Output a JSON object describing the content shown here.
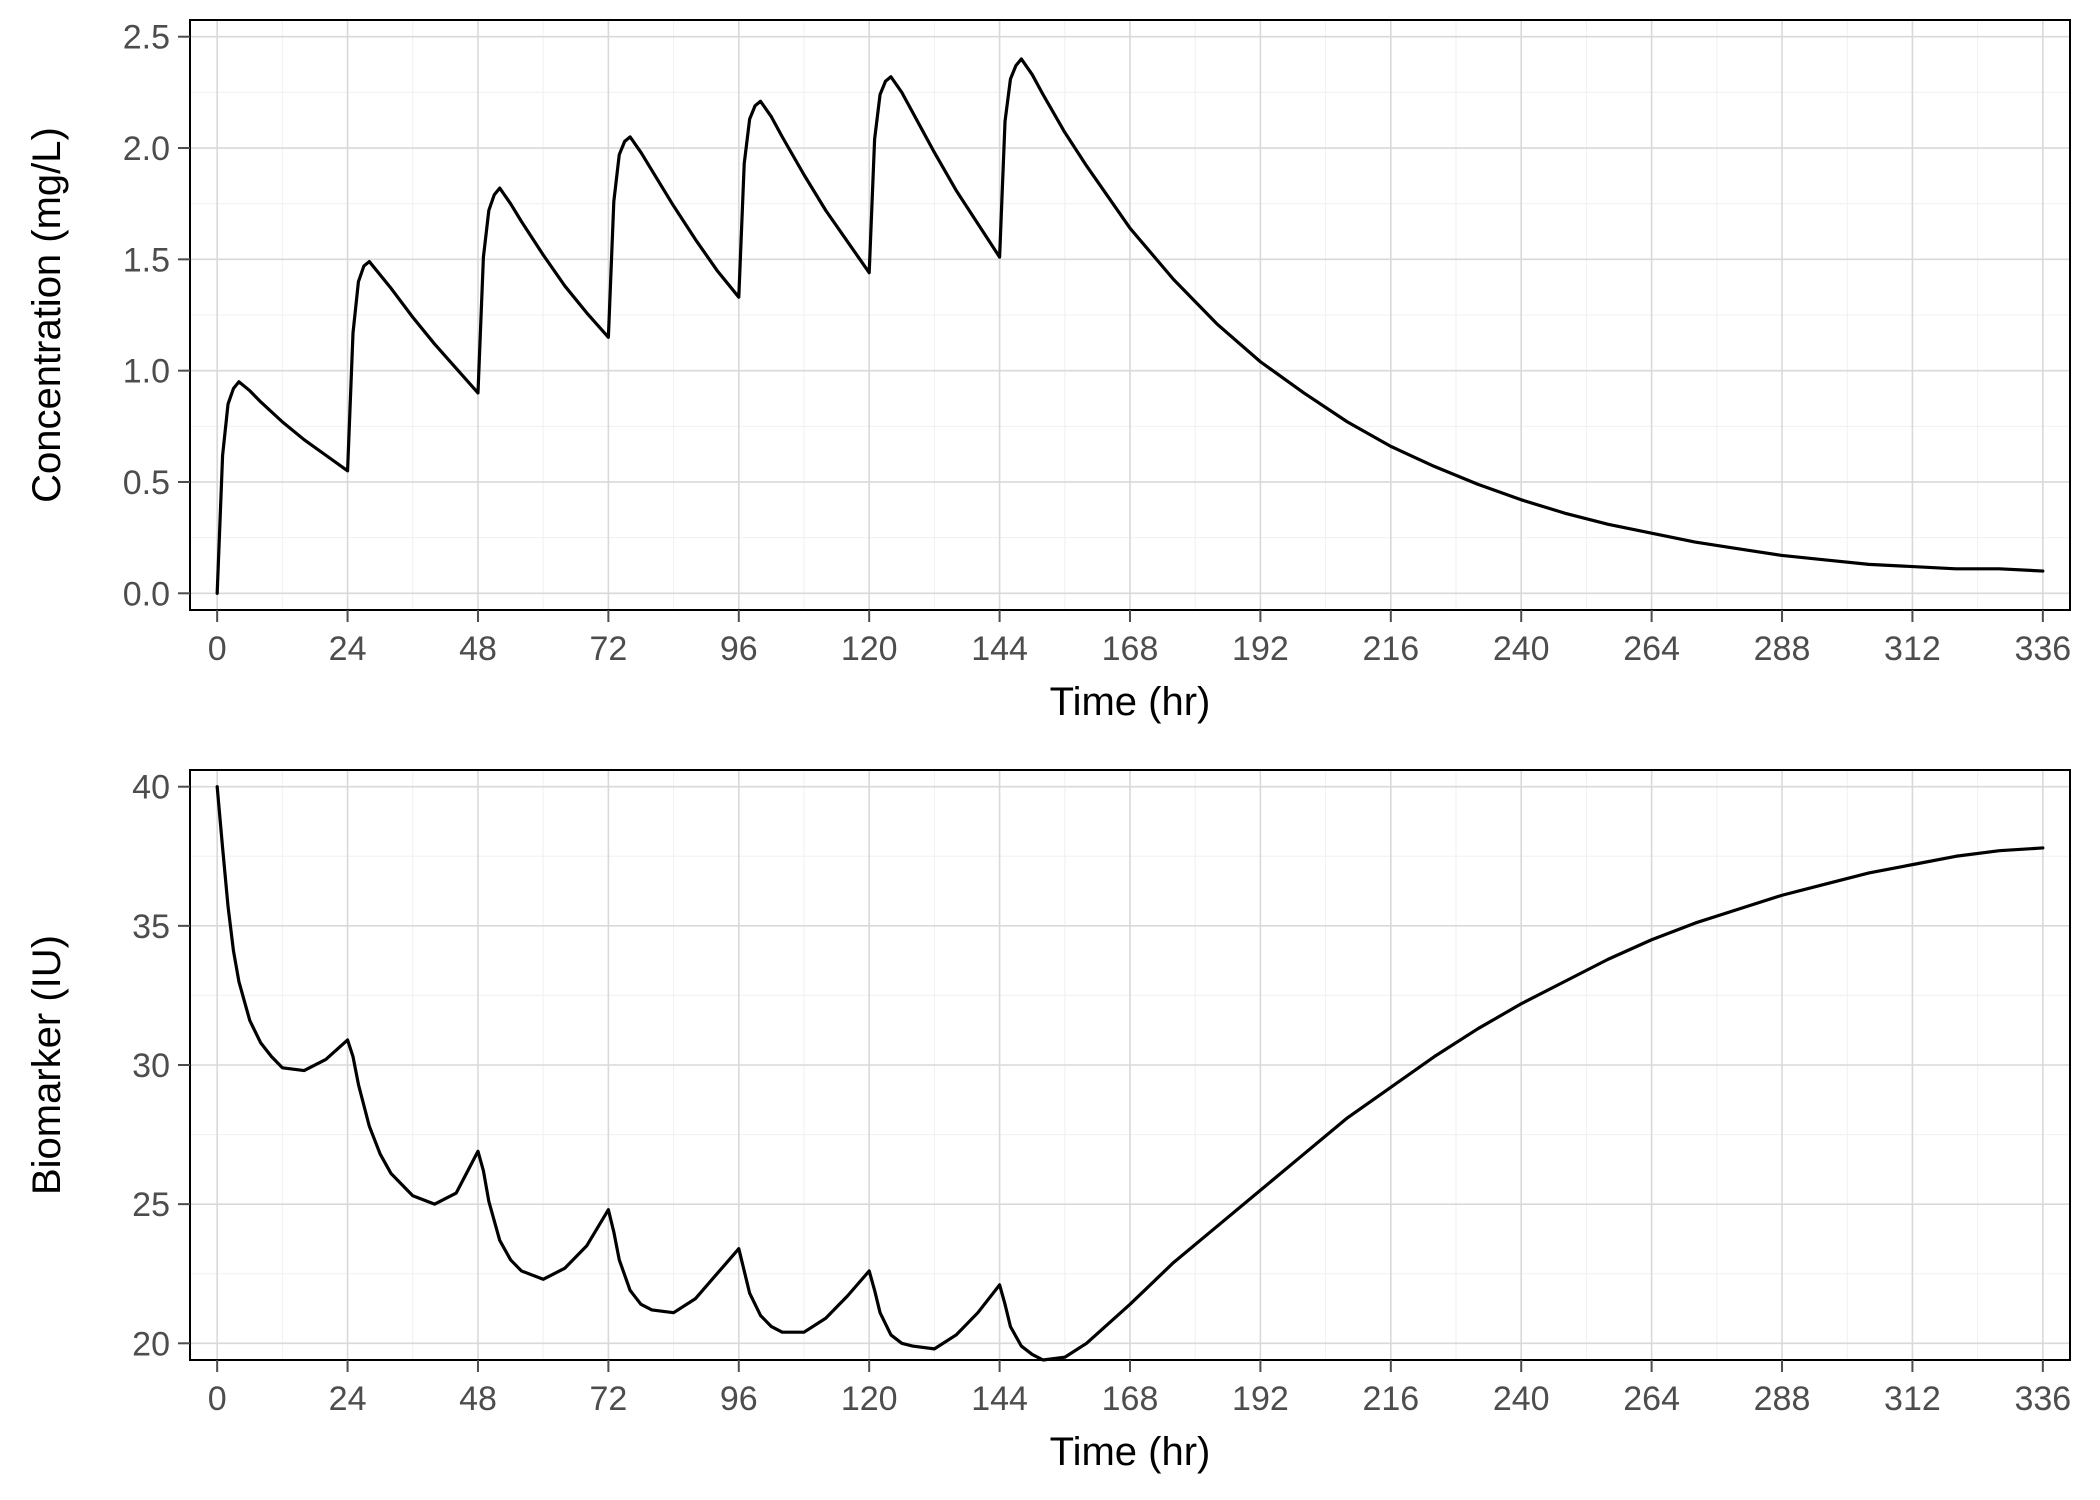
{
  "chart_data": [
    {
      "type": "line",
      "panel": "top",
      "xlabel": "Time (hr)",
      "ylabel": "Concentration (mg/L)",
      "xlim": [
        0,
        336
      ],
      "ylim": [
        0.0,
        2.5
      ],
      "x_ticks": [
        0,
        24,
        48,
        72,
        96,
        120,
        144,
        168,
        192,
        216,
        240,
        264,
        288,
        312,
        336
      ],
      "y_ticks": [
        0.0,
        0.5,
        1.0,
        1.5,
        2.0,
        2.5
      ],
      "y_minor": [
        0.25,
        0.75,
        1.25,
        1.75,
        2.25
      ],
      "series": [
        {
          "name": "Concentration",
          "x": [
            0,
            1,
            2,
            3,
            4,
            6,
            8,
            12,
            16,
            20,
            24,
            25,
            26,
            27,
            28,
            30,
            32,
            36,
            40,
            44,
            48,
            49,
            50,
            51,
            52,
            54,
            56,
            60,
            64,
            68,
            72,
            73,
            74,
            75,
            76,
            78,
            80,
            84,
            88,
            92,
            96,
            97,
            98,
            99,
            100,
            102,
            104,
            108,
            112,
            116,
            120,
            121,
            122,
            123,
            124,
            126,
            128,
            132,
            136,
            140,
            144,
            145,
            146,
            147,
            148,
            150,
            152,
            156,
            160,
            168,
            176,
            184,
            192,
            200,
            208,
            216,
            224,
            232,
            240,
            248,
            256,
            264,
            272,
            280,
            288,
            296,
            304,
            312,
            320,
            328,
            336
          ],
          "y": [
            0.0,
            0.62,
            0.85,
            0.92,
            0.95,
            0.91,
            0.86,
            0.77,
            0.69,
            0.62,
            0.55,
            1.17,
            1.4,
            1.47,
            1.49,
            1.43,
            1.37,
            1.24,
            1.12,
            1.01,
            0.9,
            1.51,
            1.72,
            1.79,
            1.82,
            1.75,
            1.67,
            1.52,
            1.38,
            1.26,
            1.15,
            1.76,
            1.97,
            2.03,
            2.05,
            1.98,
            1.9,
            1.74,
            1.59,
            1.45,
            1.33,
            1.93,
            2.13,
            2.19,
            2.21,
            2.14,
            2.05,
            1.88,
            1.72,
            1.58,
            1.44,
            2.04,
            2.24,
            2.3,
            2.32,
            2.25,
            2.16,
            1.98,
            1.81,
            1.66,
            1.51,
            2.12,
            2.31,
            2.37,
            2.4,
            2.33,
            2.24,
            2.07,
            1.92,
            1.64,
            1.41,
            1.21,
            1.04,
            0.9,
            0.77,
            0.66,
            0.57,
            0.49,
            0.42,
            0.36,
            0.31,
            0.27,
            0.23,
            0.2,
            0.17,
            0.15,
            0.13,
            0.12,
            0.11,
            0.11,
            0.1
          ]
        }
      ]
    },
    {
      "type": "line",
      "panel": "bottom",
      "xlabel": "Time (hr)",
      "ylabel": "Biomarker (IU)",
      "xlim": [
        0,
        336
      ],
      "ylim": [
        20,
        40
      ],
      "x_ticks": [
        0,
        24,
        48,
        72,
        96,
        120,
        144,
        168,
        192,
        216,
        240,
        264,
        288,
        312,
        336
      ],
      "y_ticks": [
        20,
        25,
        30,
        35,
        40
      ],
      "y_minor": [
        22.5,
        27.5,
        32.5,
        37.5
      ],
      "series": [
        {
          "name": "Biomarker",
          "x": [
            0,
            1,
            2,
            3,
            4,
            6,
            8,
            10,
            12,
            16,
            20,
            24,
            25,
            26,
            28,
            30,
            32,
            36,
            40,
            44,
            48,
            49,
            50,
            52,
            54,
            56,
            60,
            64,
            68,
            72,
            73,
            74,
            76,
            78,
            80,
            84,
            88,
            92,
            96,
            97,
            98,
            100,
            102,
            104,
            108,
            112,
            116,
            120,
            121,
            122,
            124,
            126,
            128,
            132,
            136,
            140,
            144,
            145,
            146,
            148,
            150,
            152,
            156,
            160,
            168,
            176,
            184,
            192,
            200,
            208,
            216,
            224,
            232,
            240,
            248,
            256,
            264,
            272,
            280,
            288,
            296,
            304,
            312,
            320,
            328,
            336
          ],
          "y": [
            40.0,
            37.8,
            35.7,
            34.1,
            33.0,
            31.6,
            30.8,
            30.3,
            29.9,
            29.8,
            30.2,
            30.9,
            30.3,
            29.3,
            27.8,
            26.8,
            26.1,
            25.3,
            25.0,
            25.4,
            26.9,
            26.2,
            25.1,
            23.7,
            23.0,
            22.6,
            22.3,
            22.7,
            23.5,
            24.8,
            24.0,
            23.0,
            21.9,
            21.4,
            21.2,
            21.1,
            21.6,
            22.5,
            23.4,
            22.6,
            21.8,
            21.0,
            20.6,
            20.4,
            20.4,
            20.9,
            21.7,
            22.6,
            21.9,
            21.1,
            20.3,
            20.0,
            19.9,
            19.8,
            20.3,
            21.1,
            22.1,
            21.4,
            20.6,
            19.9,
            19.6,
            19.4,
            19.5,
            20.0,
            21.4,
            22.9,
            24.2,
            25.5,
            26.8,
            28.1,
            29.2,
            30.3,
            31.3,
            32.2,
            33.0,
            33.8,
            34.5,
            35.1,
            35.6,
            36.1,
            36.5,
            36.9,
            37.2,
            37.5,
            37.7,
            37.8
          ]
        }
      ]
    }
  ]
}
